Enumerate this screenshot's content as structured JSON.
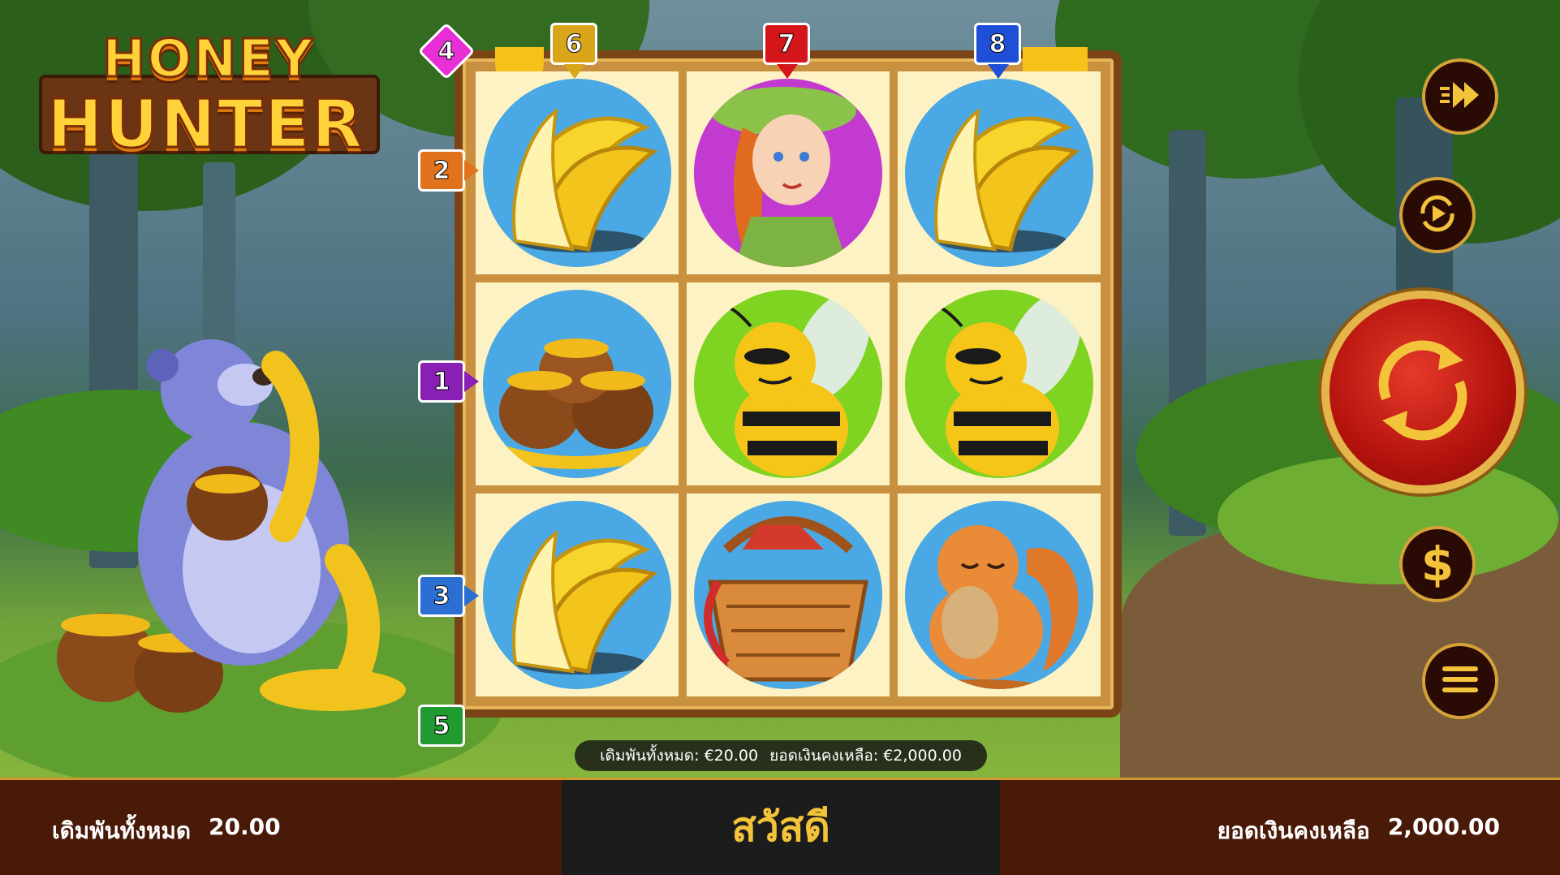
{
  "game": {
    "title_line1": "HONEY",
    "title_line2": "HUNTER"
  },
  "reels": [
    [
      "bananas",
      "explorer-girl",
      "bananas"
    ],
    [
      "honey-pots",
      "bee",
      "bee"
    ],
    [
      "bananas",
      "picnic-basket",
      "squirrel"
    ]
  ],
  "paylines": {
    "left": [
      "4",
      "2",
      "1",
      "3",
      "5"
    ],
    "top": [
      "6",
      "7",
      "8"
    ]
  },
  "info_bar": {
    "total_bet_label": "เดิมพันทั้งหมด:",
    "total_bet_value": "€20.00",
    "balance_label": "ยอดเงินคงเหลือ:",
    "balance_value": "€2,000.00"
  },
  "bottom_bar": {
    "total_bet_label": "เดิมพันทั้งหมด",
    "total_bet_value": "20.00",
    "greeting": "สวัสดี",
    "balance_label": "ยอดเงินคงเหลือ",
    "balance_value": "2,000.00"
  },
  "controls": {
    "turbo_icon": "fast-forward-icon",
    "autoplay_icon": "autoplay-icon",
    "spin_icon": "spin-arrows-icon",
    "bet_icon": "dollar-icon",
    "menu_icon": "menu-icon"
  },
  "colors": {
    "marker_1": "#8a1fb5",
    "marker_2": "#e0731c",
    "marker_3": "#2a6fd1",
    "marker_4": "#e82fd6",
    "marker_5": "#1f9b2f",
    "marker_6": "#d9a51a",
    "marker_7": "#d4161b",
    "marker_8": "#1f4fd6",
    "accent_gold": "#f3c43a",
    "spin_red": "#b3120d"
  }
}
